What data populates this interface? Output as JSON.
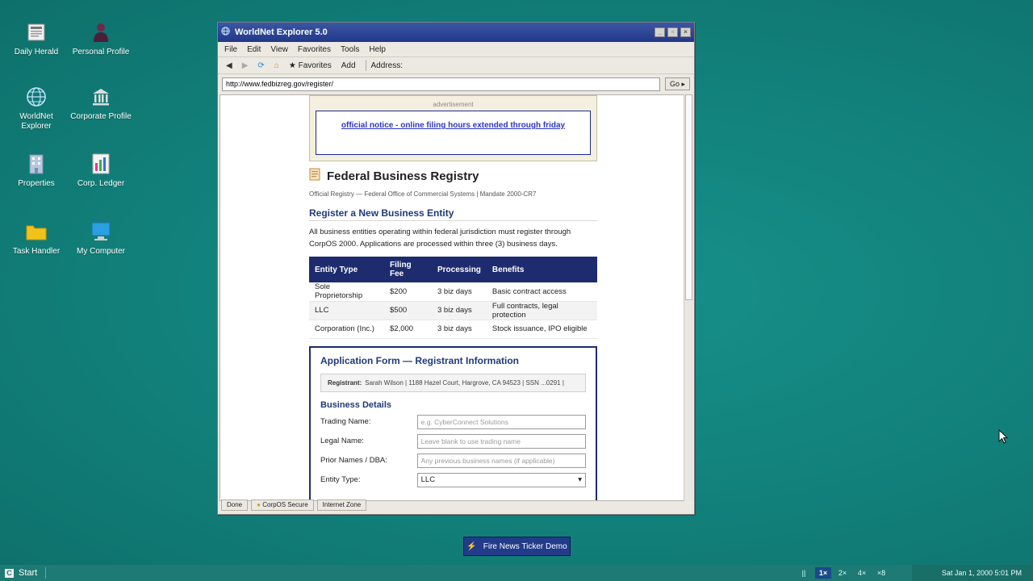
{
  "desktop_icons": [
    {
      "label": "Daily Herald",
      "icon": "newspaper-icon"
    },
    {
      "label": "Personal Profile",
      "icon": "person-icon"
    },
    {
      "label": "WorldNet Explorer",
      "icon": "globe-icon"
    },
    {
      "label": "Corporate Profile",
      "icon": "bank-icon"
    },
    {
      "label": "Properties",
      "icon": "building-icon"
    },
    {
      "label": "Corp. Ledger",
      "icon": "ledger-icon"
    },
    {
      "label": "Task Handler",
      "icon": "folder-icon"
    },
    {
      "label": "My Computer",
      "icon": "computer-icon"
    }
  ],
  "window": {
    "title": "WorldNet Explorer 5.0",
    "menu": [
      "File",
      "Edit",
      "View",
      "Favorites",
      "Tools",
      "Help"
    ],
    "toolbar": {
      "favorites": "★ Favorites",
      "add": "Add",
      "address_label": "Address:"
    },
    "address": "http://www.fedbizreg.gov/register/",
    "go": "Go ▸",
    "status": [
      "Done",
      "CorpOS Secure",
      "Internet Zone"
    ]
  },
  "page": {
    "ad_label": "advertisement",
    "ad_link": "official notice - online filing hours extended through friday",
    "title": "Federal Business Registry",
    "subtitle": "Official Registry — Federal Office of Commercial Systems  |  Mandate 2000-CR7",
    "section": "Register a New Business Entity",
    "intro": "All business entities operating within federal jurisdiction must register through CorpOS 2000. Applications are processed within three (3) business days.",
    "table": {
      "headers": [
        "Entity Type",
        "Filing Fee",
        "Processing",
        "Benefits"
      ],
      "rows": [
        [
          "Sole Proprietorship",
          "$200",
          "3 biz days",
          "Basic contract access"
        ],
        [
          "LLC",
          "$500",
          "3 biz days",
          "Full contracts, legal protection"
        ],
        [
          "Corporation (Inc.)",
          "$2,000",
          "3 biz days",
          "Stock issuance, IPO eligible"
        ]
      ]
    },
    "form": {
      "title": "Application Form — Registrant Information",
      "registrant_label": "Registrant:",
      "registrant_value": "Sarah Wilson  |  1188 Hazel Court, Hargrove, CA 94523  |  SSN ...0291  |",
      "details_title": "Business Details",
      "fields": [
        {
          "label": "Trading Name:",
          "placeholder": "e.g. CyberConnect Solutions"
        },
        {
          "label": "Legal Name:",
          "placeholder": "Leave blank to use trading name"
        },
        {
          "label": "Prior Names / DBA:",
          "placeholder": "Any previous business names (if applicable)"
        }
      ],
      "entity_label": "Entity Type:",
      "entity_value": "LLC"
    }
  },
  "ticker_button": "Fire News Ticker Demo",
  "taskbar": {
    "start": "Start",
    "speeds": [
      "||",
      "1×",
      "2×",
      "4×",
      "×8"
    ],
    "active_speed": "1×",
    "clock": "Sat Jan 1, 2000 5:01 PM"
  },
  "colors": {
    "desktop": "#12807a",
    "titlebar": "#22388a",
    "table_header": "#1e2b6e",
    "link": "#2d35c9"
  }
}
